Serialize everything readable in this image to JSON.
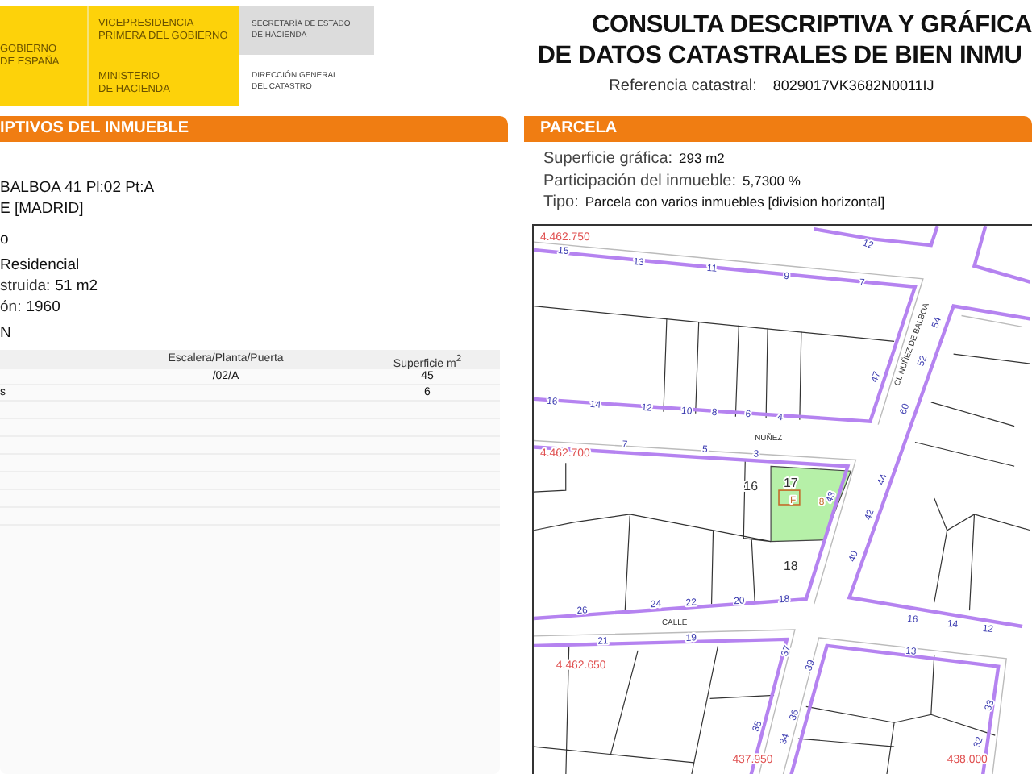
{
  "header": {
    "government": [
      "GOBIERNO",
      "DE ESPAÑA"
    ],
    "vicepresidency": [
      "VICEPRESIDENCIA",
      "PRIMERA DEL GOBIERNO"
    ],
    "ministry": [
      "MINISTERIO",
      "DE HACIENDA"
    ],
    "secretariat": [
      "SECRETARÍA DE ESTADO",
      "DE HACIENDA"
    ],
    "directorate": [
      "DIRECCIÓN GENERAL",
      "DEL CATASTRO"
    ]
  },
  "title": [
    "CONSULTA DESCRIPTIVA Y GRÁFICA",
    "DE DATOS CATASTRALES DE BIEN INMU"
  ],
  "reference": {
    "label": "Referencia catastral:",
    "value": "8029017VK3682N0011IJ"
  },
  "property": {
    "heading": "IPTIVOS DEL INMUEBLE",
    "fields": [
      {
        "value": "BALBOA 41 Pl:02 Pt:A"
      },
      {
        "value": "E [MADRID]"
      },
      {
        "value": "o"
      },
      {
        "value": "Residencial"
      },
      {
        "label": "struida:",
        "value": "51 m2"
      },
      {
        "label": "ón:",
        "value": "1960"
      }
    ],
    "table_heading": "N",
    "columns": [
      "Escalera/Planta/Puerta",
      "Superficie m$^{2}$"
    ],
    "rows": [
      {
        "column_1": "",
        "door": "/02/A",
        "area": "45"
      },
      {
        "column_1": "s",
        "area": "6"
      }
    ]
  },
  "parcel": {
    "heading": "PARCELA",
    "fields": [
      {
        "label": "Superficie gráfica:",
        "value": "293 m2"
      },
      {
        "label": "Participación del inmueble:",
        "value": "5,7300 %"
      },
      {
        "label": "Tipo:",
        "value": "Parcela con varios inmuebles [division horizontal]"
      }
    ],
    "map_labels": [
      {
        "kind": "coordinate",
        "text": "4.462.750"
      },
      {
        "kind": "coordinate",
        "text": "4.462.700"
      },
      {
        "kind": "coordinate",
        "text": "4.462.650"
      },
      {
        "kind": "coordinate",
        "text": "437.950"
      },
      {
        "kind": "coordinate",
        "text": "438.000"
      },
      {
        "kind": "street",
        "text": "NUÑEZ"
      },
      {
        "kind": "street",
        "text": "CL NUÑEZ DE BALBOA"
      },
      {
        "kind": "street",
        "text": "CALLE"
      },
      {
        "kind": "parcel",
        "text": "16"
      },
      {
        "kind": "parcel",
        "text": "17"
      },
      {
        "kind": "parcel",
        "text": "18"
      },
      {
        "kind": "number",
        "text": "15"
      },
      {
        "kind": "number",
        "text": "13"
      },
      {
        "kind": "number",
        "text": "11"
      },
      {
        "kind": "number",
        "text": "9"
      },
      {
        "kind": "number",
        "text": "7"
      },
      {
        "kind": "number",
        "text": "12"
      },
      {
        "kind": "number",
        "text": "16"
      },
      {
        "kind": "number",
        "text": "14"
      },
      {
        "kind": "number",
        "text": "12"
      },
      {
        "kind": "number",
        "text": "10"
      },
      {
        "kind": "number",
        "text": "8"
      },
      {
        "kind": "number",
        "text": "6"
      },
      {
        "kind": "number",
        "text": "4"
      },
      {
        "kind": "number",
        "text": "7"
      },
      {
        "kind": "number",
        "text": "5"
      },
      {
        "kind": "number",
        "text": "3"
      },
      {
        "kind": "number",
        "text": "47"
      },
      {
        "kind": "number",
        "text": "60"
      },
      {
        "kind": "number",
        "text": "54"
      },
      {
        "kind": "number",
        "text": "52"
      },
      {
        "kind": "number",
        "text": "43"
      },
      {
        "kind": "number",
        "text": "44"
      },
      {
        "kind": "number",
        "text": "42"
      },
      {
        "kind": "number",
        "text": "40"
      },
      {
        "kind": "number",
        "text": "26"
      },
      {
        "kind": "number",
        "text": "24"
      },
      {
        "kind": "number",
        "text": "22"
      },
      {
        "kind": "number",
        "text": "20"
      },
      {
        "kind": "number",
        "text": "18"
      },
      {
        "kind": "number",
        "text": "21"
      },
      {
        "kind": "number",
        "text": "19"
      },
      {
        "kind": "number",
        "text": "37"
      },
      {
        "kind": "number",
        "text": "39"
      },
      {
        "kind": "number",
        "text": "35"
      },
      {
        "kind": "number",
        "text": "36"
      },
      {
        "kind": "number",
        "text": "34"
      },
      {
        "kind": "number",
        "text": "13"
      },
      {
        "kind": "number",
        "text": "33"
      },
      {
        "kind": "number",
        "text": "32"
      },
      {
        "kind": "number",
        "text": "16"
      },
      {
        "kind": "number",
        "text": "14"
      },
      {
        "kind": "number",
        "text": "12"
      },
      {
        "kind": "marker",
        "text": "8"
      },
      {
        "kind": "marker",
        "text": "F"
      }
    ]
  }
}
